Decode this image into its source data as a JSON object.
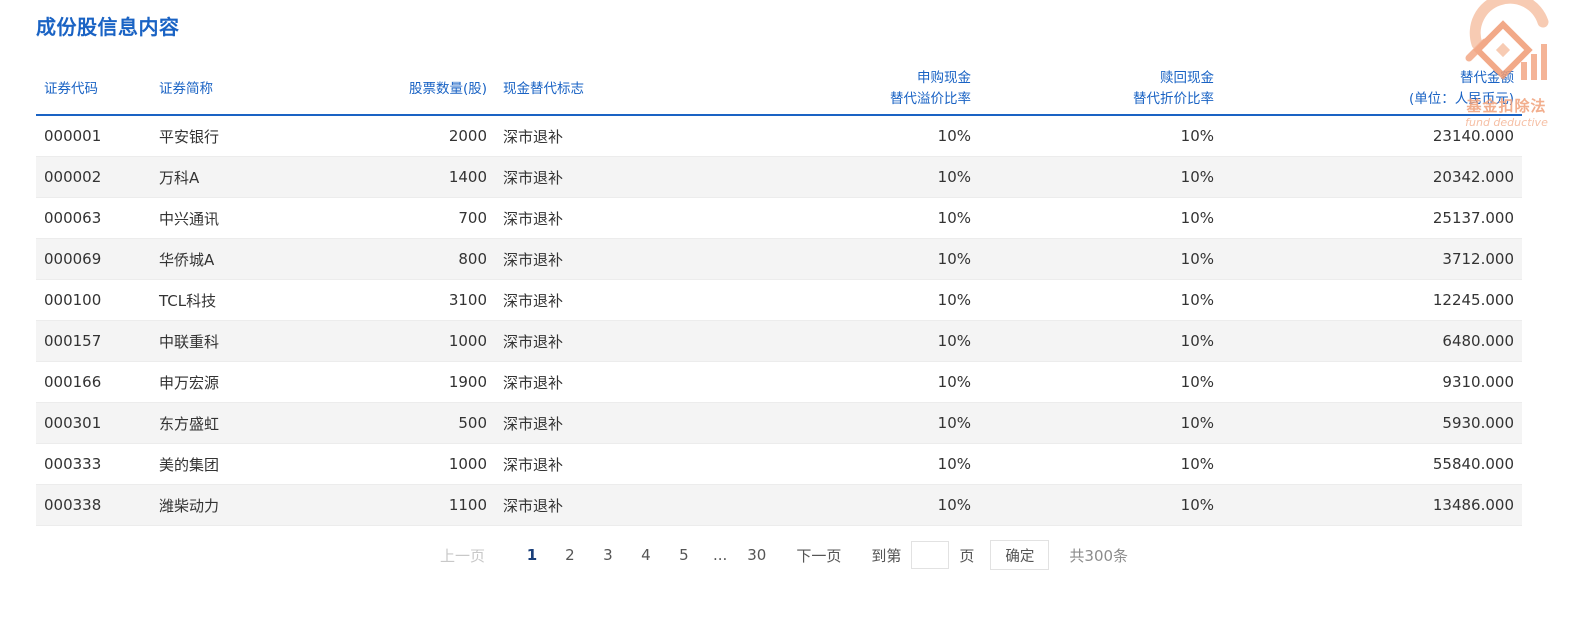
{
  "page": {
    "title": "成份股信息内容"
  },
  "table": {
    "headers": {
      "code": [
        "证券代码"
      ],
      "name": [
        "证券简称"
      ],
      "quantity": [
        "股票数量(股)"
      ],
      "flag": [
        "现金替代标志"
      ],
      "premium": [
        "申购现金",
        "替代溢价比率"
      ],
      "discount": [
        "赎回现金",
        "替代折价比率"
      ],
      "amount": [
        "替代金额",
        "(单位：人民币元)"
      ]
    },
    "rows": [
      {
        "code": "000001",
        "name": "平安银行",
        "quantity": "2000",
        "flag": "深市退补",
        "premium": "10%",
        "discount": "10%",
        "amount": "23140.000"
      },
      {
        "code": "000002",
        "name": "万科A",
        "quantity": "1400",
        "flag": "深市退补",
        "premium": "10%",
        "discount": "10%",
        "amount": "20342.000"
      },
      {
        "code": "000063",
        "name": "中兴通讯",
        "quantity": "700",
        "flag": "深市退补",
        "premium": "10%",
        "discount": "10%",
        "amount": "25137.000"
      },
      {
        "code": "000069",
        "name": "华侨城A",
        "quantity": "800",
        "flag": "深市退补",
        "premium": "10%",
        "discount": "10%",
        "amount": "3712.000"
      },
      {
        "code": "000100",
        "name": "TCL科技",
        "quantity": "3100",
        "flag": "深市退补",
        "premium": "10%",
        "discount": "10%",
        "amount": "12245.000"
      },
      {
        "code": "000157",
        "name": "中联重科",
        "quantity": "1000",
        "flag": "深市退补",
        "premium": "10%",
        "discount": "10%",
        "amount": "6480.000"
      },
      {
        "code": "000166",
        "name": "申万宏源",
        "quantity": "1900",
        "flag": "深市退补",
        "premium": "10%",
        "discount": "10%",
        "amount": "9310.000"
      },
      {
        "code": "000301",
        "name": "东方盛虹",
        "quantity": "500",
        "flag": "深市退补",
        "premium": "10%",
        "discount": "10%",
        "amount": "5930.000"
      },
      {
        "code": "000333",
        "name": "美的集团",
        "quantity": "1000",
        "flag": "深市退补",
        "premium": "10%",
        "discount": "10%",
        "amount": "55840.000"
      },
      {
        "code": "000338",
        "name": "潍柴动力",
        "quantity": "1100",
        "flag": "深市退补",
        "premium": "10%",
        "discount": "10%",
        "amount": "13486.000"
      }
    ]
  },
  "pagination": {
    "prev_label": "上一页",
    "pages": [
      "1",
      "2",
      "3",
      "4",
      "5"
    ],
    "active_page": "1",
    "ellipsis": "...",
    "last_page": "30",
    "next_label": "下一页",
    "goto_prefix": "到第",
    "goto_value": "",
    "goto_suffix": "页",
    "confirm_label": "确定",
    "total_label": "共300条"
  },
  "watermark": {
    "text": "基金扣除法",
    "subtext": "fund deductive"
  },
  "colors": {
    "accent": "#1a63c4",
    "stripe": "#f4f4f4",
    "watermark": "#f0a07a"
  }
}
